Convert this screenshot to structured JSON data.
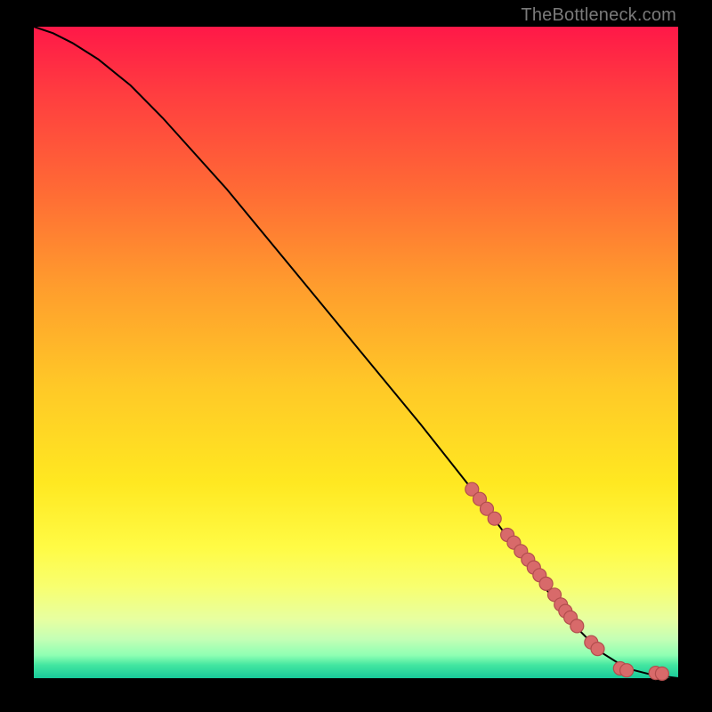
{
  "attribution": "TheBottleneck.com",
  "colors": {
    "point_fill": "#d86a6a",
    "point_stroke": "#b24d4d",
    "curve": "#000000",
    "frame": "#000000"
  },
  "chart_data": {
    "type": "line",
    "title": "",
    "xlabel": "",
    "ylabel": "",
    "xlim": [
      0,
      100
    ],
    "ylim": [
      0,
      100
    ],
    "curve": {
      "x": [
        0,
        3,
        6,
        10,
        15,
        20,
        30,
        40,
        50,
        60,
        68,
        74,
        80,
        84,
        88,
        92,
        96,
        100
      ],
      "y": [
        100,
        99,
        97.5,
        95,
        91,
        86,
        75,
        63,
        51,
        39,
        29,
        21,
        13,
        8,
        4,
        1.5,
        0.5,
        0
      ]
    },
    "series": [
      {
        "name": "points",
        "x": [
          68.0,
          69.2,
          70.3,
          71.5,
          73.5,
          74.5,
          75.6,
          76.7,
          77.6,
          78.5,
          79.5,
          80.8,
          81.8,
          82.5,
          83.3,
          84.3,
          86.5,
          87.5,
          91.0,
          92.0,
          96.5,
          97.5
        ],
        "y": [
          29.0,
          27.5,
          26.0,
          24.5,
          22.0,
          20.8,
          19.5,
          18.2,
          17.0,
          15.8,
          14.5,
          12.8,
          11.3,
          10.3,
          9.3,
          8.0,
          5.5,
          4.5,
          1.5,
          1.2,
          0.8,
          0.7
        ]
      }
    ]
  }
}
